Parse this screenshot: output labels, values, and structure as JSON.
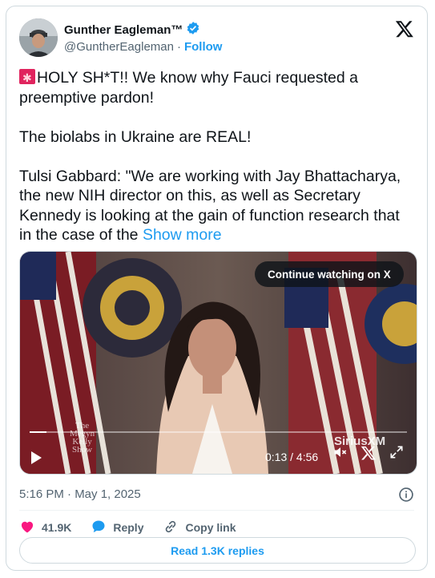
{
  "author": {
    "display_name": "Gunther Eagleman™",
    "handle": "@GuntherEagleman",
    "separator": "·",
    "follow_label": "Follow"
  },
  "tweet": {
    "text": "HOLY SH*T!! We know why Fauci requested a\npreemptive pardon!\n\nThe biolabs in Ukraine are REAL!\n\nTulsi Gabbard: \"We are working with Jay Bhattacharya,\nthe new NIH director on this, as well as Secretary\nKennedy is looking at the gain of function research that\nin the case of the ",
    "show_more_label": "Show more"
  },
  "media": {
    "continue_label": "Continue watching on X",
    "elapsed": "0:13",
    "duration": "4:56",
    "time_display": "0:13 / 4:56",
    "progress_fraction": 0.044,
    "watermark_siriusxm": "SiriusXM",
    "watermark_show": "The\nMegyn\nKelly\nShow"
  },
  "meta": {
    "timestamp": "5:16 PM · May 1, 2025"
  },
  "actions": {
    "likes": "41.9K",
    "reply_label": "Reply",
    "copy_label": "Copy link"
  },
  "read_replies_label": "Read 1.3K replies",
  "colors": {
    "accent": "#1d9bf0",
    "like": "#f91880",
    "text": "#0f1419",
    "muted": "#536471",
    "border": "#cfd9de"
  },
  "icons": [
    "verified-icon",
    "x-logo-icon",
    "siren-emoji-icon",
    "play-icon",
    "volume-icon",
    "x-mark-icon",
    "fullscreen-icon",
    "info-icon",
    "heart-icon",
    "reply-bubble-icon",
    "link-icon"
  ]
}
